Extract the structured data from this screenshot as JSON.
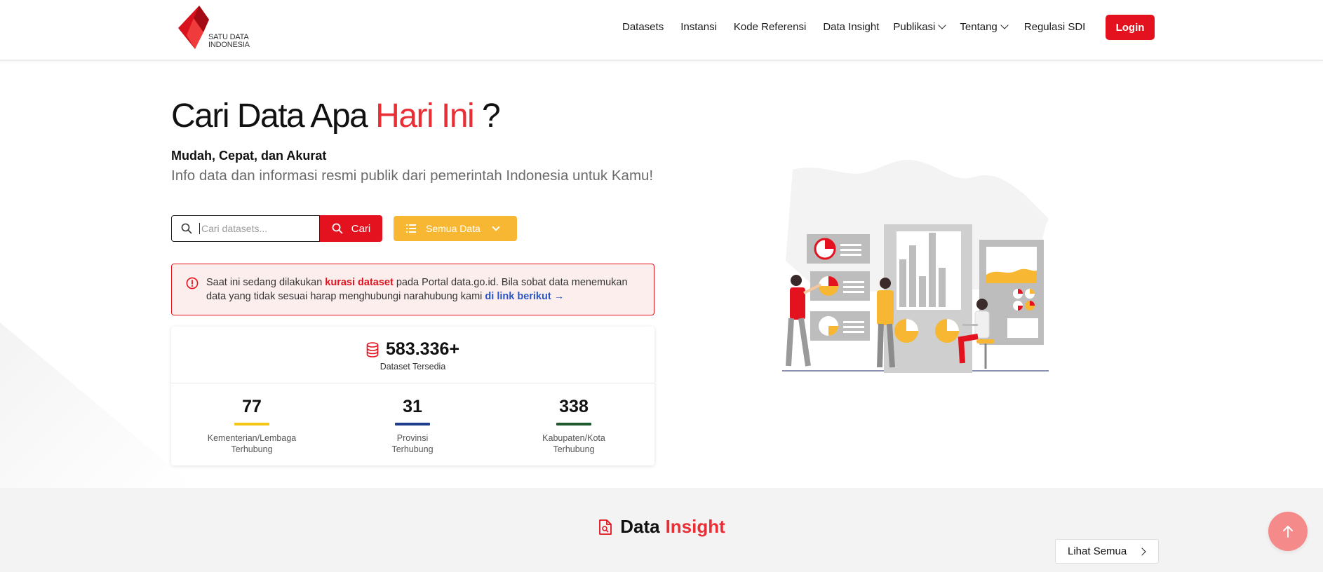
{
  "brand": {
    "logo_line1": "SATU DATA",
    "logo_line2": "INDONESIA",
    "accent": "#e4121f",
    "highlight": "#ea2e36",
    "yellow": "#f7b733"
  },
  "nav": {
    "items": [
      {
        "label": "Datasets"
      },
      {
        "label": "Instansi"
      },
      {
        "label": "Kode Referensi"
      },
      {
        "label": "Data Insight"
      },
      {
        "label": "Publikasi",
        "dropdown": true
      },
      {
        "label": "Tentang",
        "dropdown": true
      },
      {
        "label": "Regulasi SDI"
      }
    ],
    "login_label": "Login"
  },
  "hero": {
    "title_part1": "Cari Data Apa ",
    "title_highlight": "Hari Ini",
    "title_end": " ?",
    "tagline": "Mudah, Cepat, dan Akurat",
    "subtitle": "Info data dan informasi resmi publik dari pemerintah Indonesia untuk Kamu!"
  },
  "search": {
    "placeholder": "Cari datasets...",
    "value": "",
    "button_label": "Cari",
    "filter_label": "Semua Data"
  },
  "alert": {
    "text_before": "Saat ini sedang dilakukan ",
    "highlight": "kurasi dataset",
    "text_after": " pada Portal data.go.id. Bila sobat data menemukan data yang tidak sesuai harap menghubungi narahubung kami ",
    "link_label": "di link berikut →"
  },
  "stats": {
    "total_value": "583.336+",
    "total_label": "Dataset Tersedia",
    "items": [
      {
        "value": "77",
        "label_line1": "Kementerian/Lembaga",
        "label_line2": "Terhubung",
        "color": "#f5c518"
      },
      {
        "value": "31",
        "label_line1": "Provinsi",
        "label_line2": "Terhubung",
        "color": "#1f3c8f"
      },
      {
        "value": "338",
        "label_line1": "Kabupaten/Kota",
        "label_line2": "Terhubung",
        "color": "#1f5a2f"
      }
    ]
  },
  "insight": {
    "title_part1": "Data",
    "title_highlight": "Insight",
    "see_all_label": "Lihat Semua"
  }
}
